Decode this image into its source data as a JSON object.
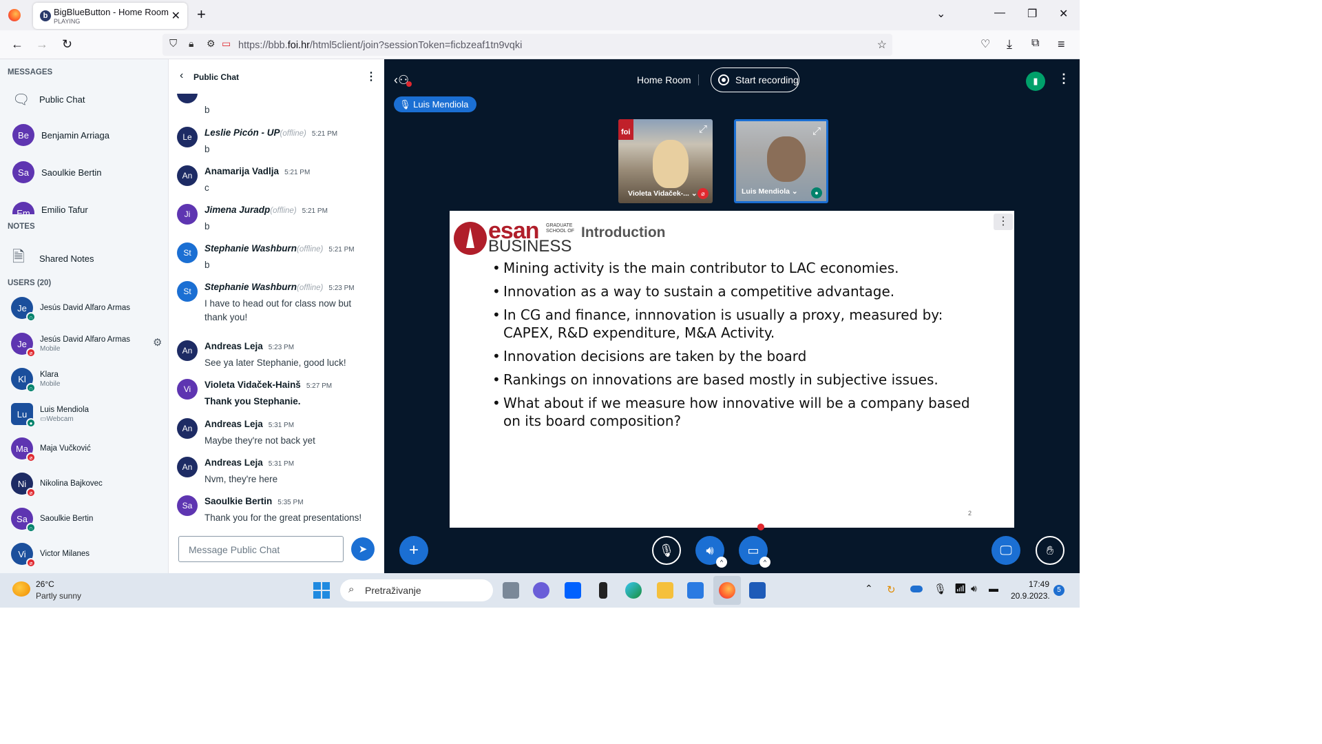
{
  "browser": {
    "tab_title": "BigBlueButton - Home Room",
    "tab_status": "PLAYING",
    "url_host_prefix": "https://bbb.",
    "url_host": "foi.hr",
    "url_path": "/html5client/join?sessionToken=ficbzeaf1tn9vqki"
  },
  "sidebar": {
    "messages_title": "MESSAGES",
    "public_chat": "Public Chat",
    "private_chats": [
      {
        "initials": "Be",
        "name": "Benjamin Arriaga"
      },
      {
        "initials": "Sa",
        "name": "Saoulkie Bertin"
      },
      {
        "initials": "Em",
        "name": "Emilio Tafur"
      }
    ],
    "notes_title": "NOTES",
    "shared_notes": "Shared Notes",
    "users_title": "USERS (20)",
    "users": [
      {
        "initials": "Je",
        "name": "Jesús David Alfaro Armas",
        "sub": "",
        "status": "green"
      },
      {
        "initials": "Je",
        "name": "Jesús David Alfaro Armas",
        "sub": "Mobile",
        "status": "red"
      },
      {
        "initials": "Kl",
        "name": "Klara",
        "sub": "Mobile",
        "status": "green"
      },
      {
        "initials": "Lu",
        "name": "Luis Mendiola",
        "sub": "Webcam",
        "status": "green"
      },
      {
        "initials": "Ma",
        "name": "Maja Vučković",
        "sub": "",
        "status": "red"
      },
      {
        "initials": "Ni",
        "name": "Nikolina Bajkovec",
        "sub": "",
        "status": "red"
      },
      {
        "initials": "Sa",
        "name": "Saoulkie Bertin",
        "sub": "",
        "status": "green"
      },
      {
        "initials": "Vi",
        "name": "Victor Milanes",
        "sub": "",
        "status": "red"
      }
    ]
  },
  "chat": {
    "title": "Public Chat",
    "offline_label": "(offline)",
    "messages": [
      {
        "initials": "Le",
        "sender": "Leslie Picón - UP",
        "offline": true,
        "time": "5:21 PM",
        "text": "b"
      },
      {
        "initials": "An",
        "sender": "Anamarija Vadlja",
        "offline": false,
        "time": "5:21 PM",
        "text": "c"
      },
      {
        "initials": "Ji",
        "sender": "Jimena Juradp",
        "offline": true,
        "time": "5:21 PM",
        "text": "b"
      },
      {
        "initials": "St",
        "sender": "Stephanie Washburn",
        "offline": true,
        "time": "5:21 PM",
        "text": "b"
      },
      {
        "initials": "St",
        "sender": "Stephanie Washburn",
        "offline": true,
        "time": "5:23 PM",
        "text": "I have to head out for class now but thank you!"
      },
      {
        "initials": "An",
        "sender": "Andreas Leja",
        "offline": false,
        "time": "5:23 PM",
        "text": "See ya later Stephanie, good luck!"
      },
      {
        "initials": "Vi",
        "sender": "Violeta Vidaček-Hainš",
        "offline": false,
        "time": "5:27 PM",
        "text": "Thank you Stephanie."
      },
      {
        "initials": "An",
        "sender": "Andreas Leja",
        "offline": false,
        "time": "5:31 PM",
        "text": "Maybe they're not back yet"
      },
      {
        "initials": "An",
        "sender": "Andreas Leja",
        "offline": false,
        "time": "5:31 PM",
        "text": "Nvm, they're here"
      },
      {
        "initials": "Sa",
        "sender": "Saoulkie Bertin",
        "offline": false,
        "time": "5:35 PM",
        "text": "Thank you for the great presentations!"
      }
    ],
    "top_partial_text": "b",
    "composer_placeholder": "Message Public Chat"
  },
  "meeting": {
    "room_title": "Home Room",
    "record_label": "Start recording",
    "talking_user": "Luis Mendiola",
    "videos": [
      {
        "name": "Violeta Vidaček-...",
        "logo": "foi"
      },
      {
        "name": "Luis Mendiola"
      }
    ]
  },
  "slide": {
    "logo_main": "esan",
    "logo_side": "GRADUATE SCHOOL OF",
    "logo_sub": "BUSINESS",
    "heading": "Introduction",
    "bullets": [
      "Mining activity is the main contributor to LAC economies.",
      "Innovation as a way to sustain a competitive advantage.",
      "In CG and finance, innnovation is usually a proxy, measured by: CAPEX, R&D expenditure, M&A Activity.",
      "Innovation decisions are taken by the board",
      "Rankings on innovations are based mostly in subjective issues.",
      "What about if we measure how innovative will be a company based on its board composition?"
    ],
    "page_number": "2"
  },
  "taskbar": {
    "temperature": "26°C",
    "weather": "Partly sunny",
    "search_placeholder": "Pretraživanje",
    "time": "17:49",
    "date": "20.9.2023.",
    "notification_count": "5"
  },
  "colors": {
    "bbb_dark": "#06172a",
    "bbb_blue": "#1b6fd3",
    "avatar_purple": "#5e35b1",
    "status_red": "#e0282f",
    "status_green": "#00826b"
  }
}
